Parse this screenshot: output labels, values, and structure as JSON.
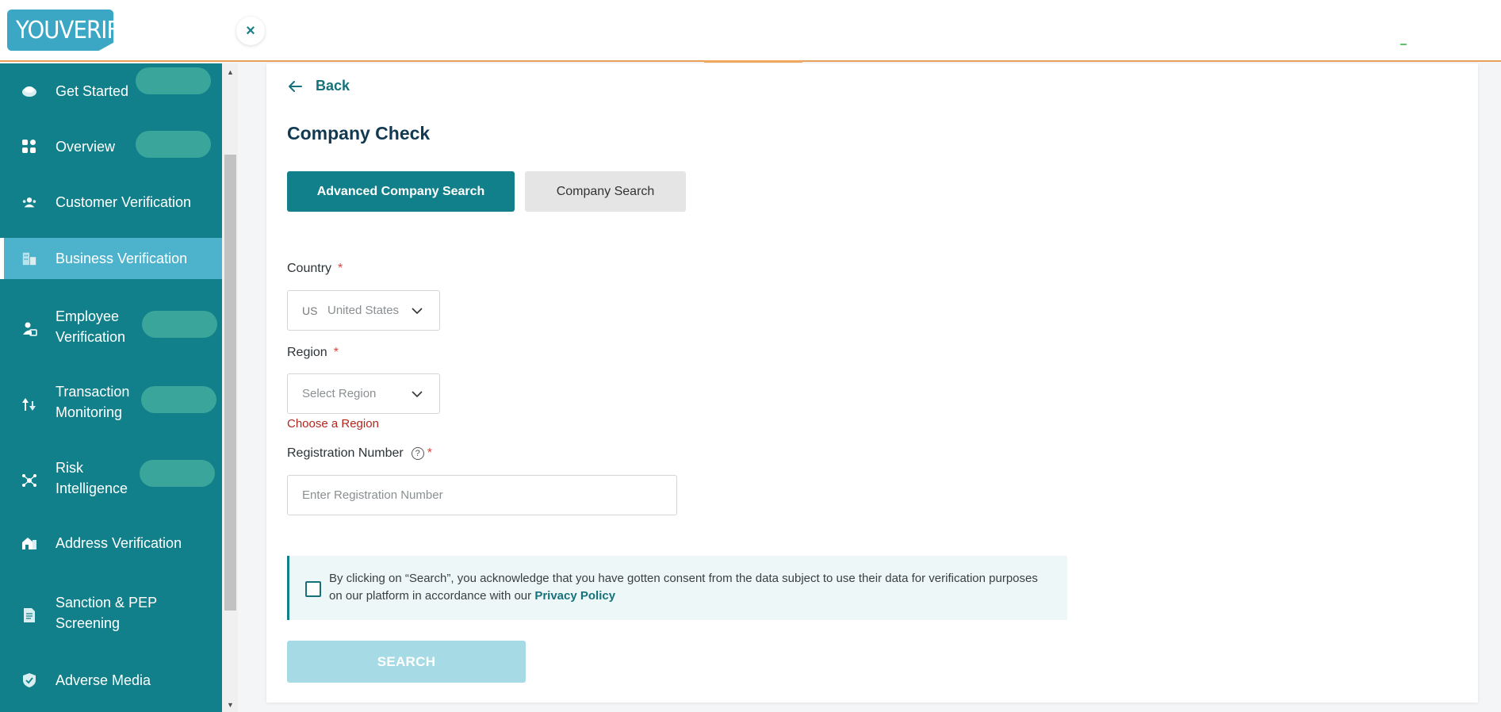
{
  "brand": {
    "logo_text": "YOUVERIFY"
  },
  "header": {
    "close_label": "×"
  },
  "sidebar": {
    "items": [
      {
        "label": "Get Started",
        "icon": "rocket-icon"
      },
      {
        "label": "Overview",
        "icon": "grid-icon"
      },
      {
        "label": "Customer Verification",
        "icon": "users-icon"
      },
      {
        "label": "Business Verification",
        "icon": "building-icon",
        "active": true
      },
      {
        "label": "Employee Verification",
        "icon": "employee-icon"
      },
      {
        "label": "Transaction Monitoring",
        "icon": "transaction-icon"
      },
      {
        "label": "Risk Intelligence",
        "icon": "network-icon"
      },
      {
        "label": "Address Verification",
        "icon": "house-icon"
      },
      {
        "label": "Sanction & PEP Screening",
        "icon": "document-icon"
      },
      {
        "label": "Adverse Media",
        "icon": "shield-icon"
      }
    ]
  },
  "main": {
    "back_label": "Back",
    "title": "Company Check",
    "tabs": [
      {
        "label": "Advanced Company Search",
        "active": true
      },
      {
        "label": "Company Search",
        "active": false
      }
    ],
    "form": {
      "country_label": "Country",
      "country_code": "US",
      "country_value": "United States",
      "region_label": "Region",
      "region_placeholder": "Select Region",
      "region_error": "Choose a Region",
      "registration_label": "Registration Number",
      "registration_placeholder": "Enter Registration Number",
      "required_mark": "*",
      "help_glyph": "?"
    },
    "consent": {
      "text": "By clicking on “Search”, you acknowledge that you have gotten consent from the data subject to use their data for verification purposes on our platform in accordance with our ",
      "link": "Privacy Policy",
      "checked": false
    },
    "search_button": "SEARCH"
  },
  "colors": {
    "sidebar_bg": "#12808a",
    "sidebar_active": "#4db3cc",
    "primary": "#12808a",
    "logo_bg": "#3ba7c4",
    "error": "#b3261e",
    "disabled_button": "#a6dbe6"
  }
}
